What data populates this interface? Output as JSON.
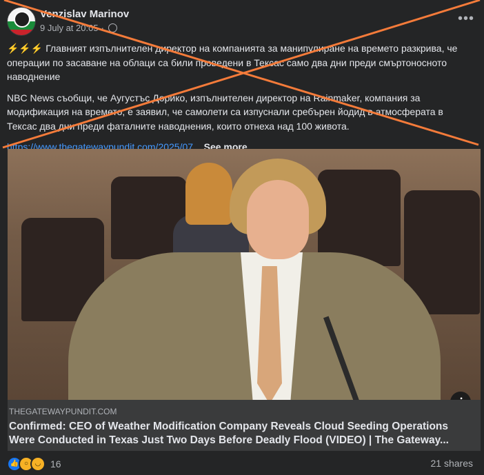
{
  "post": {
    "author": "Venzislav Marinov",
    "date": "9 July at 20:05",
    "privacy_icon": "globe-icon",
    "more_icon": "more-dots-icon",
    "zap_emojis": "⚡⚡⚡",
    "paragraph1": "Главният изпълнителен директор на компанията за манипулиране на времето разкрива, че операции по засаване на облаци са били проведени в Тексас само два дни преди смъртоносното наводнение",
    "paragraph2": "NBC News съобщи, че Аугустъс Дорико, изпълнителен директор на Rainmaker, компания за модификация на времето, е заявил, че самолети са изпуснали сребърен йодид в атмосферата в Тексас два дни преди фаталните наводнения, които отнеха над 100 живота.",
    "link_text": "https://www.thegatewaypundit.com/2025/07",
    "ellipsis": "...",
    "see_more": "See more"
  },
  "link_card": {
    "domain": "THEGATEWAYPUNDIT.COM",
    "headline": "Confirmed: CEO of Weather Modification Company Reveals Cloud Seeding Operations Were Conducted in Texas Just Two Days Before Deadly Flood (VIDEO) | The Gateway...",
    "info_label": "i"
  },
  "footer": {
    "reaction_count": "16",
    "shares": "21 shares"
  },
  "colors": {
    "background": "#242526",
    "link": "#4599ff",
    "cross_out": "#f47b3a"
  }
}
